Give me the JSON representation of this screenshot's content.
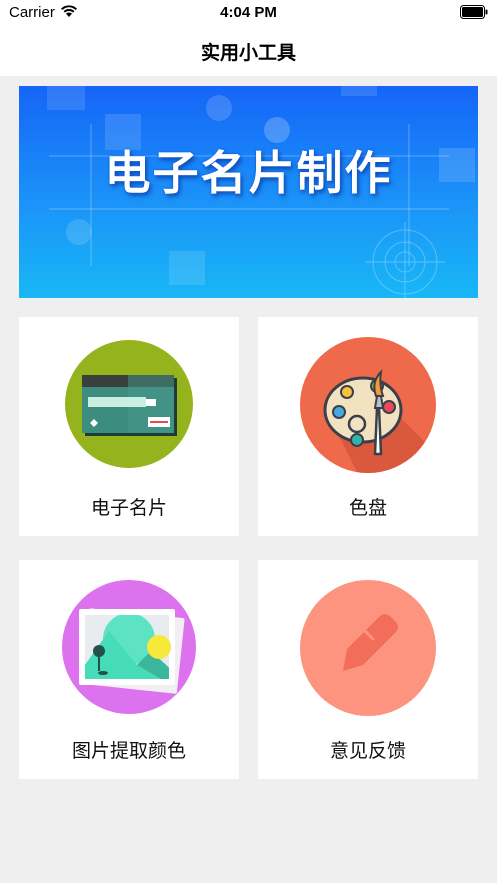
{
  "status_bar": {
    "carrier": "Carrier",
    "time": "4:04 PM"
  },
  "nav": {
    "title": "实用小工具"
  },
  "banner": {
    "title": "电子名片制作"
  },
  "tools": [
    {
      "label": "电子名片",
      "icon": "business-card-icon",
      "color": "#95b31c"
    },
    {
      "label": "色盘",
      "icon": "palette-icon",
      "color": "#ef6a4a"
    },
    {
      "label": "图片提取颜色",
      "icon": "picture-icon",
      "color": "#d97af0"
    },
    {
      "label": "意见反馈",
      "icon": "feedback-pencil-icon",
      "color": "#fd9480"
    }
  ]
}
